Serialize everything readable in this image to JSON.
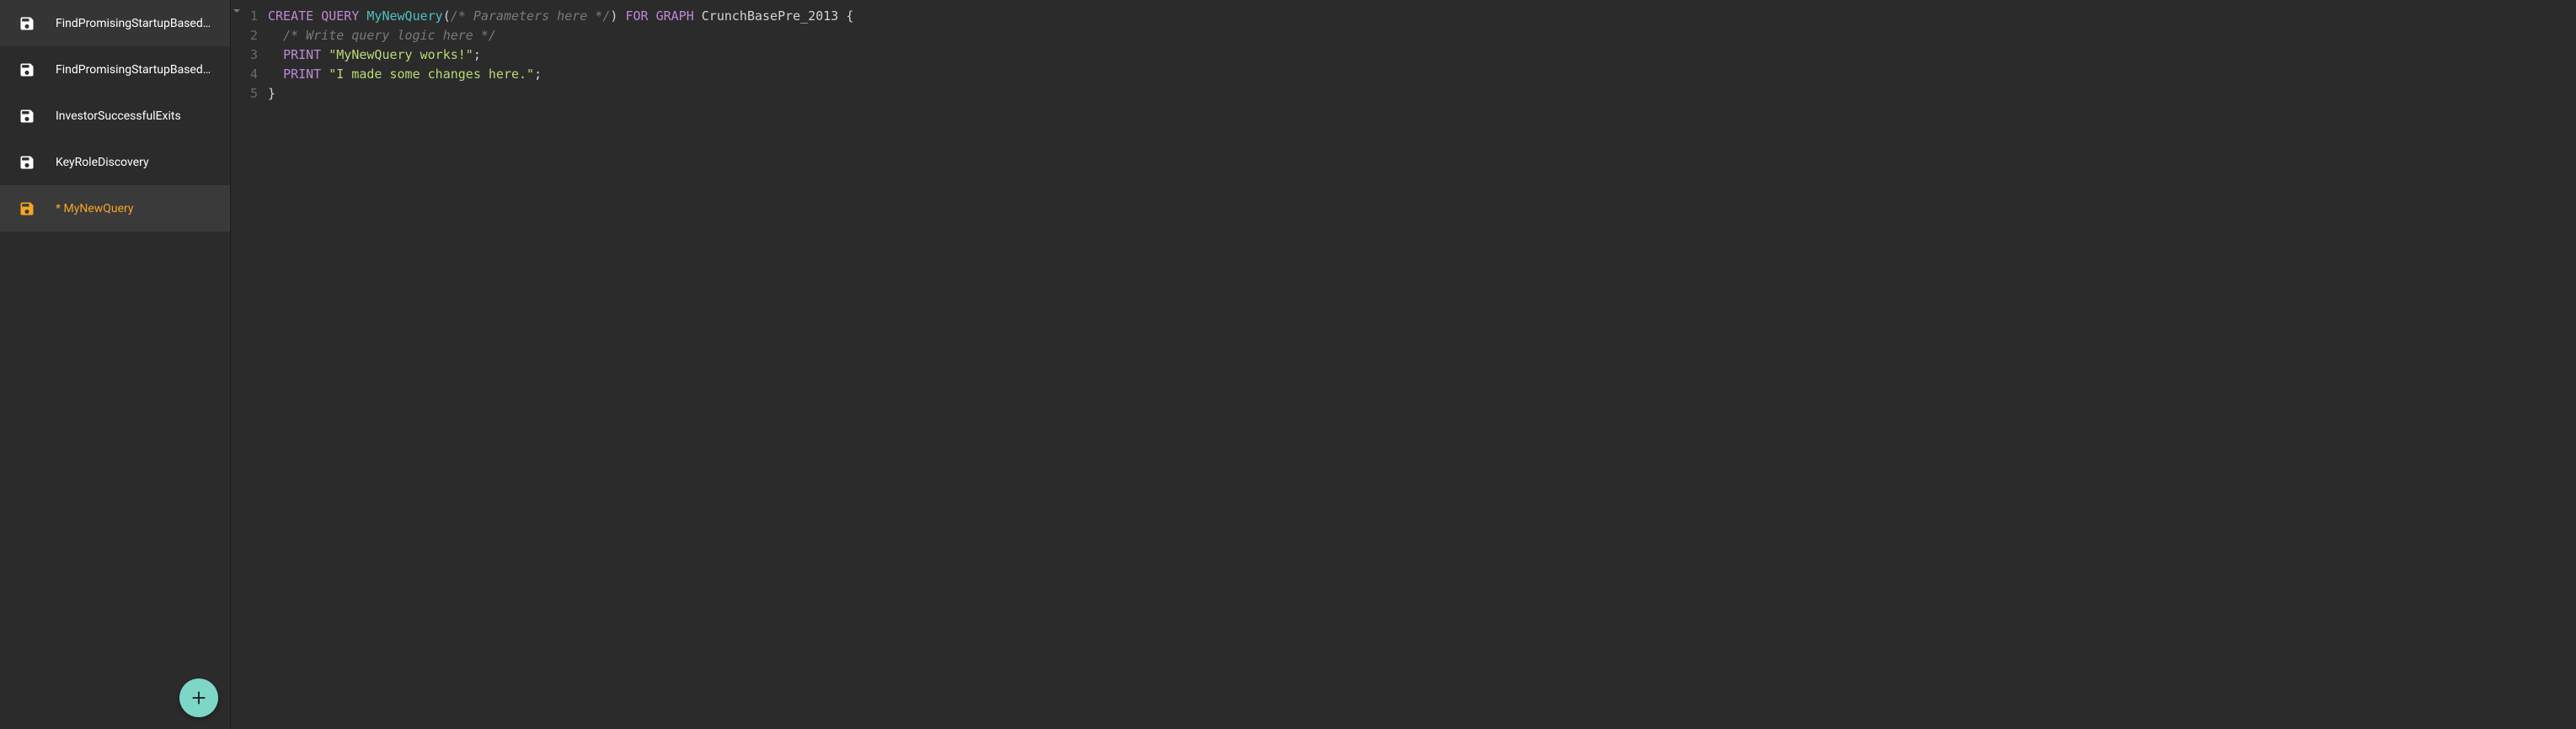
{
  "sidebar": {
    "items": [
      {
        "label": "FindPromisingStartupBased…",
        "active": false,
        "modified": false
      },
      {
        "label": "FindPromisingStartupBased…",
        "active": false,
        "modified": false
      },
      {
        "label": "InvestorSuccessfulExits",
        "active": false,
        "modified": false
      },
      {
        "label": "KeyRoleDiscovery",
        "active": false,
        "modified": false
      },
      {
        "label": "* MyNewQuery",
        "active": true,
        "modified": true
      }
    ]
  },
  "editor": {
    "lines": [
      {
        "num": "1",
        "tokens": [
          {
            "t": "CREATE QUERY",
            "c": "tok-keyword"
          },
          {
            "t": " ",
            "c": ""
          },
          {
            "t": "MyNewQuery",
            "c": "tok-func"
          },
          {
            "t": "(",
            "c": "tok-punct"
          },
          {
            "t": "/* Parameters here */",
            "c": "tok-comment"
          },
          {
            "t": ")",
            "c": "tok-punct"
          },
          {
            "t": " ",
            "c": ""
          },
          {
            "t": "FOR GRAPH",
            "c": "tok-keyword"
          },
          {
            "t": " ",
            "c": ""
          },
          {
            "t": "CrunchBasePre_2013",
            "c": "tok-ident"
          },
          {
            "t": " {",
            "c": "tok-punct"
          }
        ]
      },
      {
        "num": "2",
        "tokens": [
          {
            "t": "  ",
            "c": ""
          },
          {
            "t": "/* Write query logic here */",
            "c": "tok-comment"
          }
        ]
      },
      {
        "num": "3",
        "tokens": [
          {
            "t": "  ",
            "c": ""
          },
          {
            "t": "PRINT",
            "c": "tok-keyword"
          },
          {
            "t": " ",
            "c": ""
          },
          {
            "t": "\"MyNewQuery works!\"",
            "c": "tok-string"
          },
          {
            "t": ";",
            "c": "tok-punct"
          }
        ]
      },
      {
        "num": "4",
        "tokens": [
          {
            "t": "  ",
            "c": ""
          },
          {
            "t": "PRINT",
            "c": "tok-keyword"
          },
          {
            "t": " ",
            "c": ""
          },
          {
            "t": "\"I made some changes here.\"",
            "c": "tok-string"
          },
          {
            "t": ";",
            "c": "tok-punct"
          }
        ]
      },
      {
        "num": "5",
        "tokens": [
          {
            "t": "}",
            "c": "tok-punct"
          }
        ]
      }
    ]
  }
}
